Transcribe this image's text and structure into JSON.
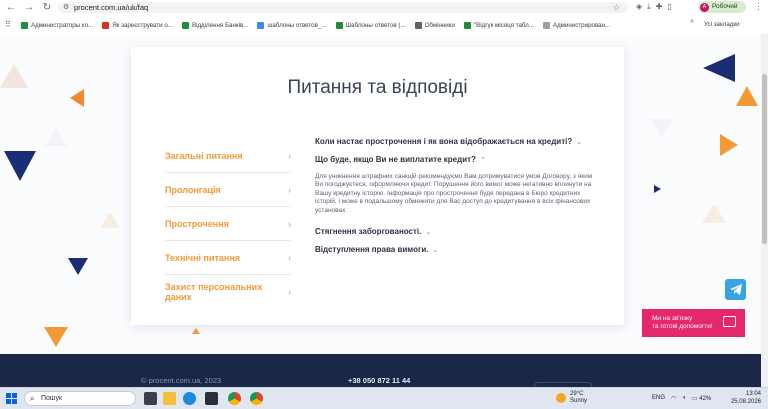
{
  "browser": {
    "url": "procent.com.ua/uk/faq",
    "profile_initial": "A",
    "profile_name": "Робочий",
    "bookmarks": [
      {
        "label": "Администраторы ко...",
        "color": "#1e8e3e"
      },
      {
        "label": "Як зареєструвати о...",
        "color": "#d93025"
      },
      {
        "label": "Відділення Банків...",
        "color": "#1e8e3e"
      },
      {
        "label": "шаблоны ответов_...",
        "color": "#4285f4"
      },
      {
        "label": "Шаблоны ответов (...",
        "color": "#1e8e3e"
      },
      {
        "label": "Обмінники",
        "color": "#5f6368"
      },
      {
        "label": "\"Відгук місяця табл...",
        "color": "#1e8e3e"
      },
      {
        "label": "Администрирован...",
        "color": "#9aa0a6"
      }
    ],
    "all_bookmarks_label": "Усі закладки"
  },
  "page": {
    "title": "Питання та відповіді",
    "categories": [
      "Загальні питання",
      "Пролонгація",
      "Прострочення",
      "Технічні питання",
      "Захист персональних даних"
    ],
    "faq": [
      {
        "question": "Коли настає прострочення і як вона відображається на кредиті?",
        "expanded": false
      },
      {
        "question": "Що буде, якщо Ви не виплатите кредит?",
        "expanded": true,
        "answer": "Для уникнення штрафних санкцій рекомендуємо Вам дотримуватися умов Договору, з яким Ви погоджуєтеся, оформляючи кредит. Порушення його вимог може негативно вплинути на Вашу кредитну історію. Інформація про прострочення буде передана в Бюро кредитних історій, і може в подальшому обмежити для Вас доступ до кредитування в всіх фінансових установах."
      },
      {
        "question": "Стягнення заборгованості.",
        "expanded": false
      },
      {
        "question": "Відступлення права вимоги.",
        "expanded": false
      }
    ],
    "contact_button_line1": "Ми на зв'язку",
    "contact_button_line2": "та готові допомогти!",
    "footer_copyright": "© procent.com.ua, 2023",
    "footer_phone": "+38 050 872 11 44",
    "accent_color": "#f39a37",
    "dark_color": "#1b2747"
  },
  "taskbar": {
    "search_placeholder": "Пошук",
    "weather_temp": "29°C",
    "weather_desc": "Sunny",
    "lang": "ENG",
    "battery": "42%",
    "time": "13:04",
    "date": "25.08.2026"
  }
}
